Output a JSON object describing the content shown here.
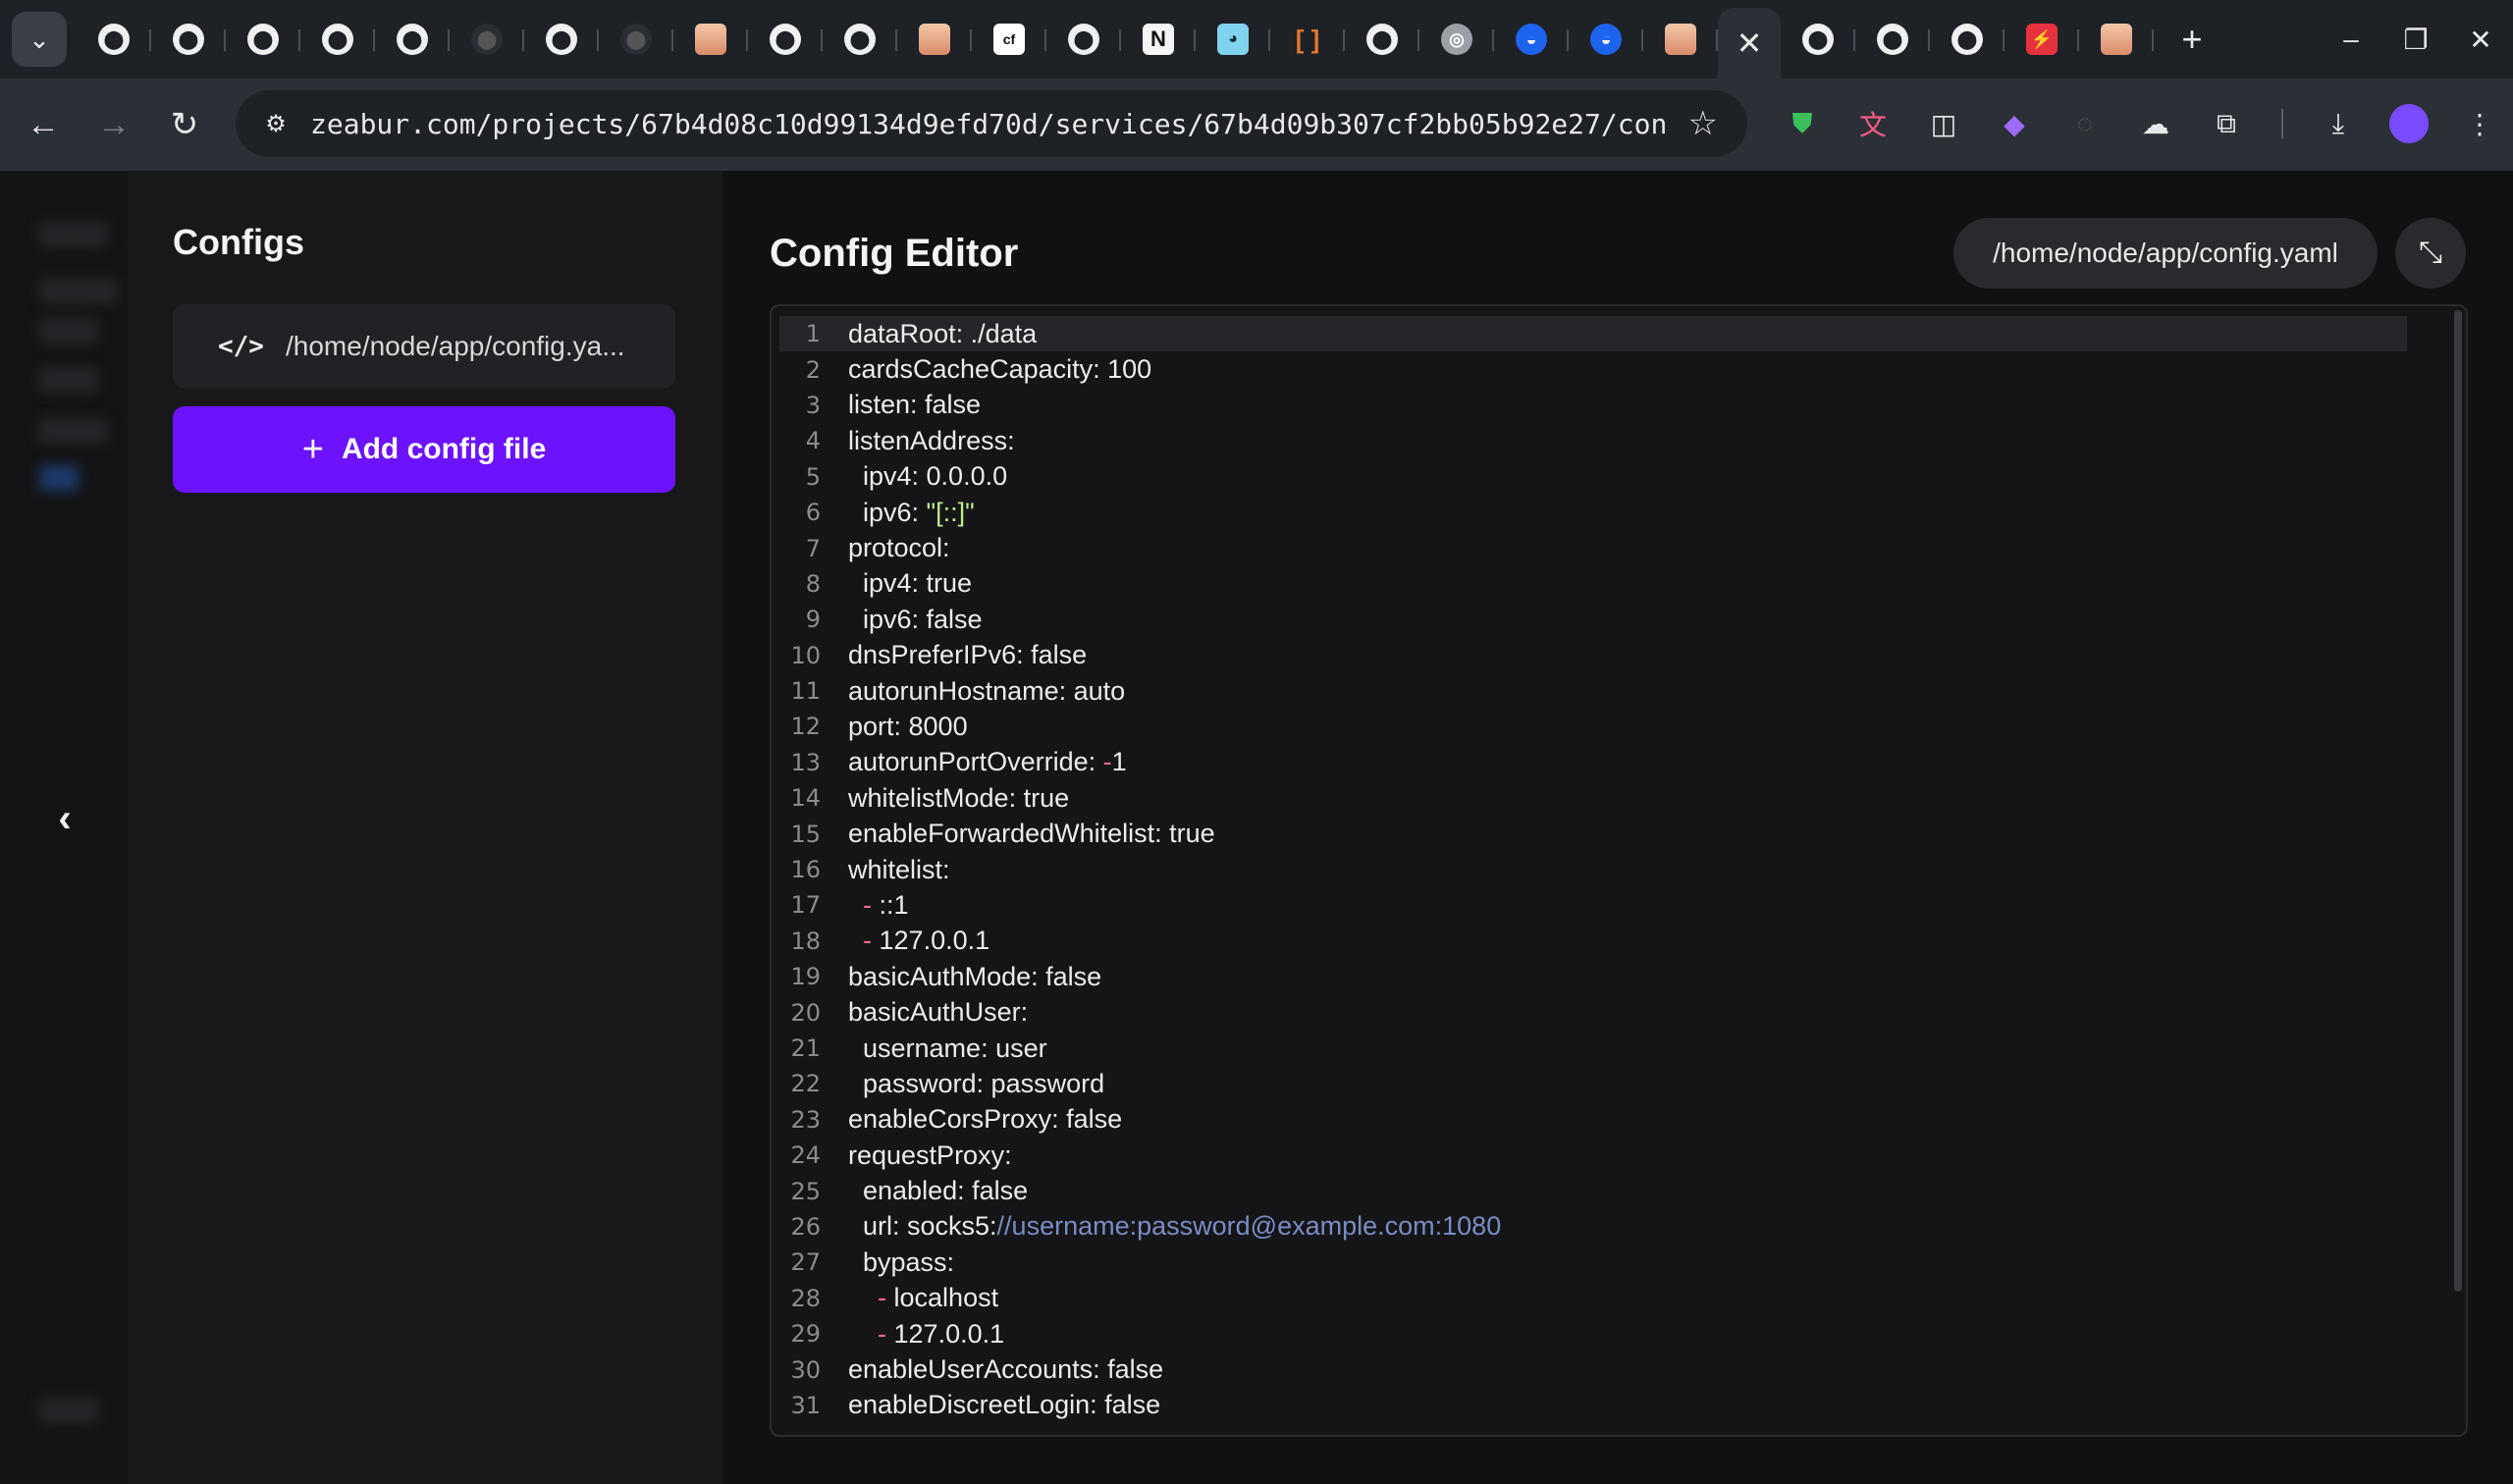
{
  "browser": {
    "tabs": [
      {
        "icon": "github-icon",
        "kind": "gh"
      },
      {
        "icon": "github-icon",
        "kind": "gh"
      },
      {
        "icon": "github-icon",
        "kind": "gh"
      },
      {
        "icon": "github-icon",
        "kind": "gh"
      },
      {
        "icon": "github-icon",
        "kind": "gh"
      },
      {
        "icon": "github-icon",
        "kind": "gh-dim"
      },
      {
        "icon": "github-icon",
        "kind": "gh"
      },
      {
        "icon": "github-icon",
        "kind": "gh-dim"
      },
      {
        "icon": "anime-avatar-icon",
        "kind": "anime"
      },
      {
        "icon": "github-icon",
        "kind": "gh"
      },
      {
        "icon": "github-icon",
        "kind": "gh"
      },
      {
        "icon": "anime-avatar-icon",
        "kind": "anime"
      },
      {
        "icon": "cf-icon",
        "kind": "cf"
      },
      {
        "icon": "github-icon",
        "kind": "gh"
      },
      {
        "icon": "notion-icon",
        "kind": "n"
      },
      {
        "icon": "gopher-icon",
        "kind": "go"
      },
      {
        "icon": "bracket-icon",
        "kind": "bracket"
      },
      {
        "icon": "github-icon",
        "kind": "gh"
      },
      {
        "icon": "chrome-icon",
        "kind": "chrome"
      },
      {
        "icon": "docker-icon",
        "kind": "docker"
      },
      {
        "icon": "docker-icon",
        "kind": "docker"
      },
      {
        "icon": "anime-avatar-icon",
        "kind": "anime"
      }
    ],
    "active_tab_close": "✕",
    "tabs_after": [
      {
        "icon": "github-icon",
        "kind": "gh"
      },
      {
        "icon": "github-icon",
        "kind": "gh"
      },
      {
        "icon": "github-icon",
        "kind": "gh"
      },
      {
        "icon": "bolt-icon",
        "kind": "bolt"
      },
      {
        "icon": "anime-avatar-icon",
        "kind": "anime"
      }
    ],
    "new_tab": "+",
    "url": "zeabur.com/projects/67b4d08c10d99134d9efd70d/services/67b4d09b307cf2bb05b92e27/con…"
  },
  "sidebar": {
    "title": "Configs",
    "file_item": "/home/node/app/config.ya...",
    "add_button": "Add config file"
  },
  "editor": {
    "title": "Config Editor",
    "path": "/home/node/app/config.yaml",
    "lines": [
      [
        {
          "t": "dataRoot: ./data"
        }
      ],
      [
        {
          "t": "cardsCacheCapacity: 100"
        }
      ],
      [
        {
          "t": "listen: false"
        }
      ],
      [
        {
          "t": "listenAddress:"
        }
      ],
      [
        {
          "t": "  ipv4: 0.0.0.0"
        }
      ],
      [
        {
          "t": "  ipv6: "
        },
        {
          "t": "\"[::]\"",
          "c": "str"
        }
      ],
      [
        {
          "t": "protocol:"
        }
      ],
      [
        {
          "t": "  ipv4: true"
        }
      ],
      [
        {
          "t": "  ipv6: false"
        }
      ],
      [
        {
          "t": "dnsPreferIPv6: false"
        }
      ],
      [
        {
          "t": "autorunHostname: auto"
        }
      ],
      [
        {
          "t": "port: 8000"
        }
      ],
      [
        {
          "t": "autorunPortOverride: "
        },
        {
          "t": "-",
          "c": "dash"
        },
        {
          "t": "1"
        }
      ],
      [
        {
          "t": "whitelistMode: true"
        }
      ],
      [
        {
          "t": "enableForwardedWhitelist: true"
        }
      ],
      [
        {
          "t": "whitelist:"
        }
      ],
      [
        {
          "t": "  "
        },
        {
          "t": "-",
          "c": "dash"
        },
        {
          "t": " ::1"
        }
      ],
      [
        {
          "t": "  "
        },
        {
          "t": "-",
          "c": "dash"
        },
        {
          "t": " 127.0.0.1"
        }
      ],
      [
        {
          "t": "basicAuthMode: false"
        }
      ],
      [
        {
          "t": "basicAuthUser:"
        }
      ],
      [
        {
          "t": "  username: user"
        }
      ],
      [
        {
          "t": "  password: password"
        }
      ],
      [
        {
          "t": "enableCorsProxy: false"
        }
      ],
      [
        {
          "t": "requestProxy:"
        }
      ],
      [
        {
          "t": "  enabled: false"
        }
      ],
      [
        {
          "t": "  url: socks5:"
        },
        {
          "t": "//username:password@example.com:1080",
          "c": "link"
        }
      ],
      [
        {
          "t": "  bypass:"
        }
      ],
      [
        {
          "t": "    "
        },
        {
          "t": "-",
          "c": "dash"
        },
        {
          "t": " localhost"
        }
      ],
      [
        {
          "t": "    "
        },
        {
          "t": "-",
          "c": "dash"
        },
        {
          "t": " 127.0.0.1"
        }
      ],
      [
        {
          "t": "enableUserAccounts: false"
        }
      ],
      [
        {
          "t": "enableDiscreetLogin: false"
        }
      ]
    ]
  },
  "colors": {
    "accent": "#6c12ff",
    "string": "#c3e88d",
    "dash": "#ff6b8a",
    "link": "#7a8cc4"
  }
}
